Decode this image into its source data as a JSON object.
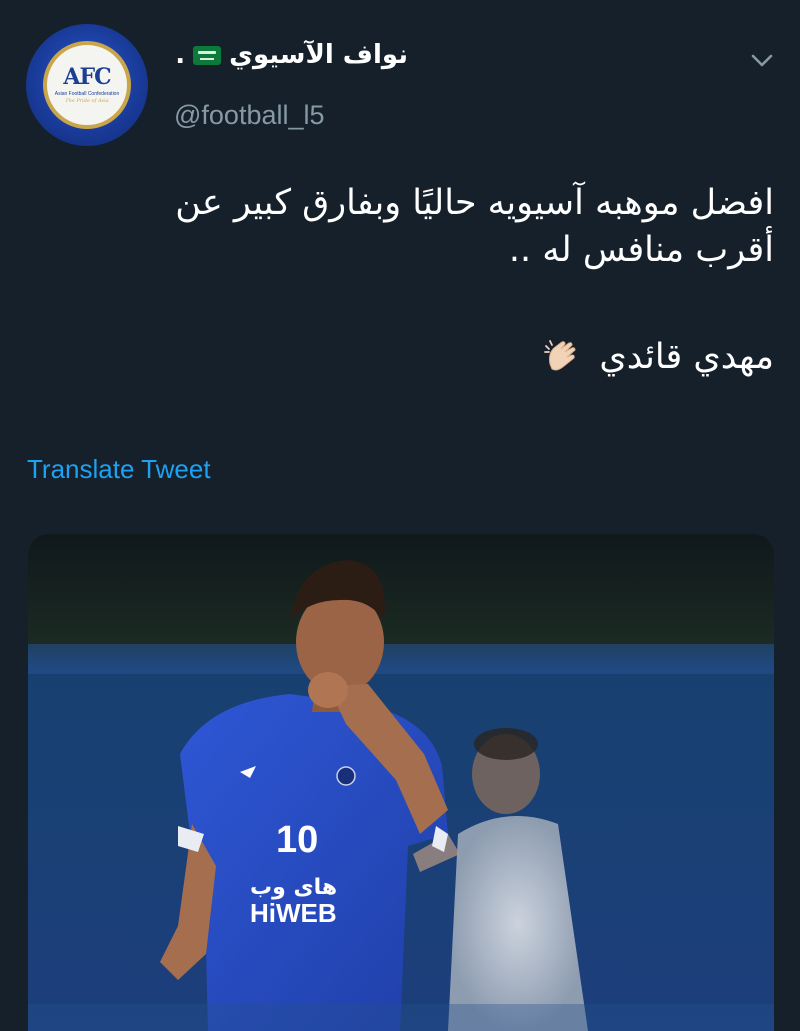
{
  "tweet": {
    "display_name": "نواف الآسيوي",
    "name_suffix": ".",
    "handle": "@football_l5",
    "text_lines": [
      "افضل موهبه آسيويه حاليًا وبفارق كبير عن",
      "أقرب منافس له .."
    ],
    "text_line_last": "مهدي قائدي",
    "translate_label": "Translate Tweet"
  },
  "avatar": {
    "logo_text": "AFC",
    "logo_subtitle": "Asian Football Confederation",
    "logo_script": "The Pride of Asia"
  },
  "media": {
    "jersey_number": "10",
    "sponsor_arabic": "های وب",
    "sponsor_latin": "HiWEB"
  },
  "icons": {
    "caret": "chevron-down-icon",
    "flag": "saudi-flag-icon",
    "clap": "clapping-hands-icon"
  },
  "colors": {
    "background": "#15202b",
    "handle": "#8899a6",
    "link": "#1da1f2"
  }
}
